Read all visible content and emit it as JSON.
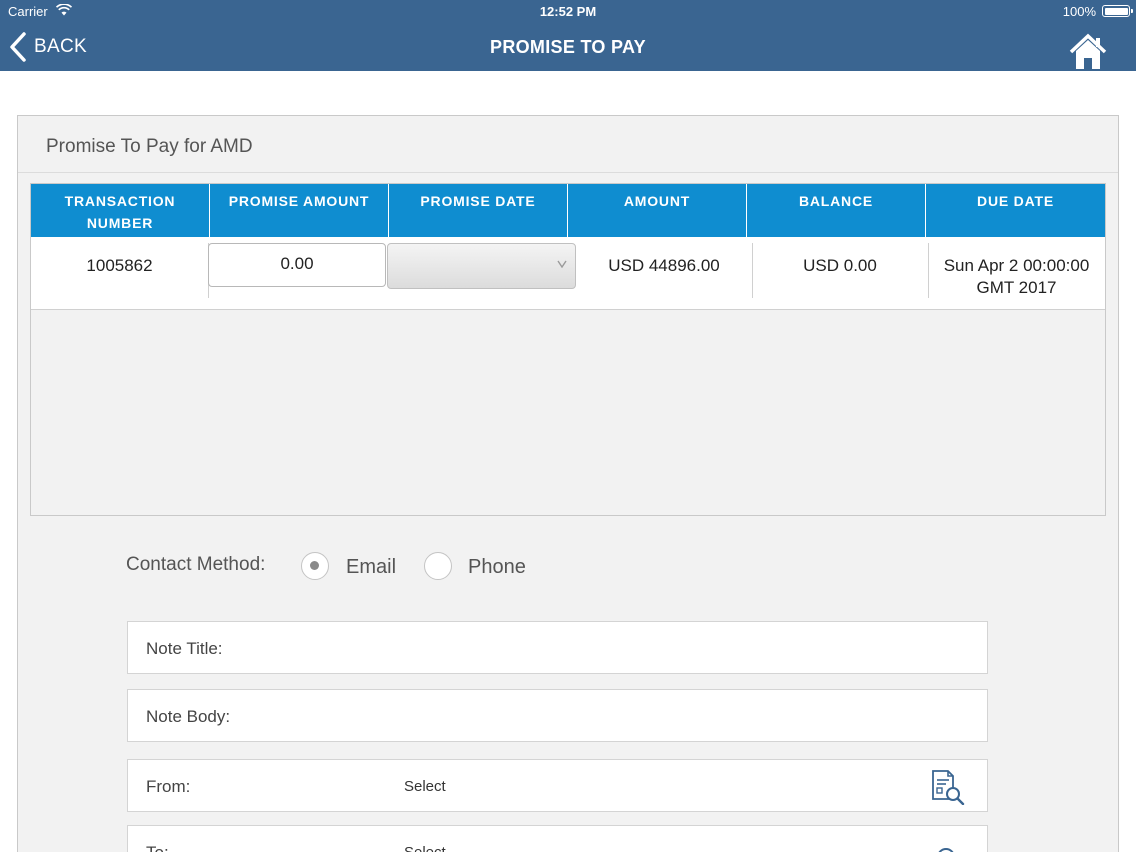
{
  "status_bar": {
    "carrier": "Carrier",
    "time": "12:52 PM",
    "battery": "100%"
  },
  "header": {
    "back_label": "BACK",
    "title": "PROMISE TO PAY"
  },
  "colors": {
    "header_bg": "#3a6591",
    "table_header_bg": "#0f8dd0"
  },
  "card": {
    "title": "Promise To Pay for AMD"
  },
  "table": {
    "columns": [
      [
        "TRANSACTION",
        "NUMBER"
      ],
      [
        "PROMISE AMOUNT"
      ],
      [
        "PROMISE DATE"
      ],
      [
        "AMOUNT"
      ],
      [
        "BALANCE"
      ],
      [
        "DUE DATE"
      ]
    ],
    "rows": [
      {
        "transaction_number": "1005862",
        "promise_amount": "0.00",
        "promise_date": "",
        "amount": "USD 44896.00",
        "balance": "USD 0.00",
        "due_date": [
          "Sun Apr 2 00:00:00",
          "GMT 2017"
        ]
      }
    ]
  },
  "contact": {
    "label": "Contact Method:",
    "options": [
      {
        "label": "Email",
        "selected": true
      },
      {
        "label": "Phone",
        "selected": false
      }
    ]
  },
  "form": {
    "note_title_label": "Note Title:",
    "note_body_label": "Note Body:",
    "from_label": "From:",
    "from_value": "Select",
    "to_label": "To:",
    "to_value": "Select"
  }
}
